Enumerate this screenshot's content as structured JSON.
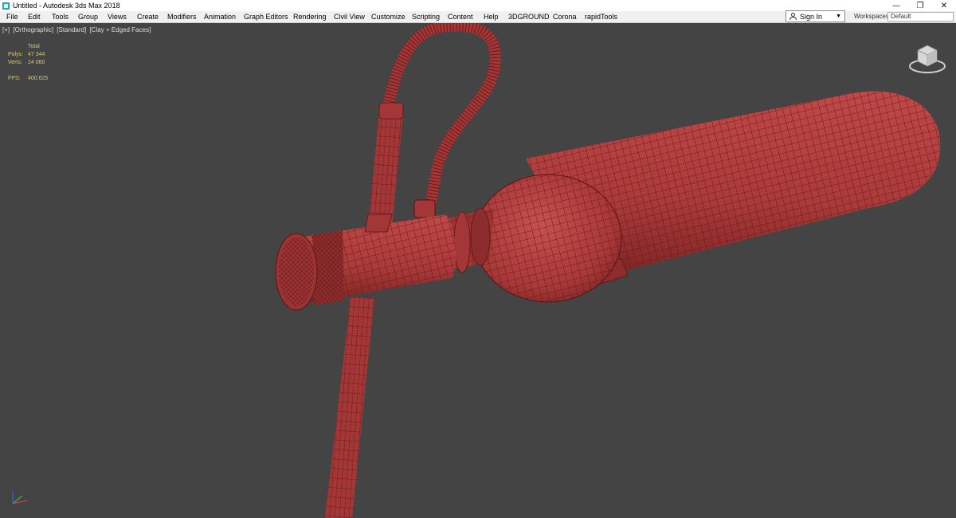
{
  "window": {
    "title": "Untitled - Autodesk 3ds Max 2018",
    "minimize_glyph": "—",
    "restore_glyph": "❐",
    "close_glyph": "✕"
  },
  "menu": {
    "items": [
      "File",
      "Edit",
      "Tools",
      "Group",
      "Views",
      "Create",
      "Modifiers",
      "Animation",
      "Graph Editors",
      "Rendering",
      "Civil View",
      "Customize",
      "Scripting",
      "Content",
      "Help",
      "3DGROUND",
      "Corona",
      "rapidTools"
    ]
  },
  "signin": {
    "label": "Sign In",
    "dropdown_glyph": "▼"
  },
  "workspaces": {
    "label": "Workspaces:",
    "value": "Default"
  },
  "viewport": {
    "labels": [
      "[+]",
      "[Orthographic]",
      "[Standard]",
      "[Clay + Edged Faces]"
    ],
    "stats": {
      "header": "Total",
      "polys_label": "Polys:",
      "polys_value": "47 344",
      "verts_label": "Verts:",
      "verts_value": "24 060",
      "fps_label": "FPS:",
      "fps_value": "400,625"
    },
    "clay_color": "#b03d3d",
    "wire_color": "#5a1414",
    "background": "#444444"
  },
  "icons": [
    "app-icon",
    "user-icon",
    "viewcube-icon",
    "axis-tripod-icon"
  ]
}
